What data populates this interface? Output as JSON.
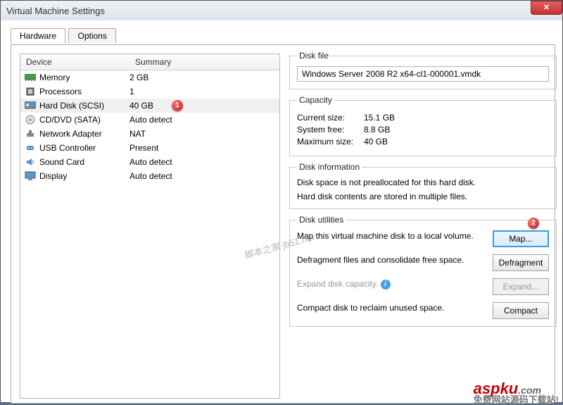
{
  "window": {
    "title": "Virtual Machine Settings"
  },
  "tabs": {
    "hardware": "Hardware",
    "options": "Options"
  },
  "headers": {
    "device": "Device",
    "summary": "Summary"
  },
  "devices": [
    {
      "icon": "memory-icon",
      "name": "Memory",
      "summary": "2 GB"
    },
    {
      "icon": "cpu-icon",
      "name": "Processors",
      "summary": "1"
    },
    {
      "icon": "hdd-icon",
      "name": "Hard Disk (SCSI)",
      "summary": "40 GB",
      "selected": true,
      "badge": "1"
    },
    {
      "icon": "cd-icon",
      "name": "CD/DVD (SATA)",
      "summary": "Auto detect"
    },
    {
      "icon": "net-icon",
      "name": "Network Adapter",
      "summary": "NAT"
    },
    {
      "icon": "usb-icon",
      "name": "USB Controller",
      "summary": "Present"
    },
    {
      "icon": "sound-icon",
      "name": "Sound Card",
      "summary": "Auto detect"
    },
    {
      "icon": "display-icon",
      "name": "Display",
      "summary": "Auto detect"
    }
  ],
  "diskfile": {
    "legend": "Disk file",
    "value": "Windows Server 2008 R2 x64-cl1-000001.vmdk"
  },
  "capacity": {
    "legend": "Capacity",
    "current_lbl": "Current size:",
    "current": "15.1 GB",
    "free_lbl": "System free:",
    "free": "8.8 GB",
    "max_lbl": "Maximum size:",
    "max": "40 GB"
  },
  "diskinfo": {
    "legend": "Disk information",
    "line1": "Disk space is not preallocated for this hard disk.",
    "line2": "Hard disk contents are stored in multiple files."
  },
  "utilities": {
    "legend": "Disk utilities",
    "map_txt": "Map this virtual machine disk to a local volume.",
    "map_btn": "Map...",
    "map_badge": "2",
    "defrag_txt": "Defragment files and consolidate free space.",
    "defrag_btn": "Defragment",
    "expand_txt": "Expand disk capacity.",
    "expand_btn": "Expand...",
    "compact_txt": "Compact disk to reclaim unused space.",
    "compact_btn": "Compact"
  },
  "watermark": "脚本之家 jb51.net",
  "brand": {
    "main": "aspku",
    "suffix": ".com",
    "sub": "免费网站源码下载站!"
  }
}
